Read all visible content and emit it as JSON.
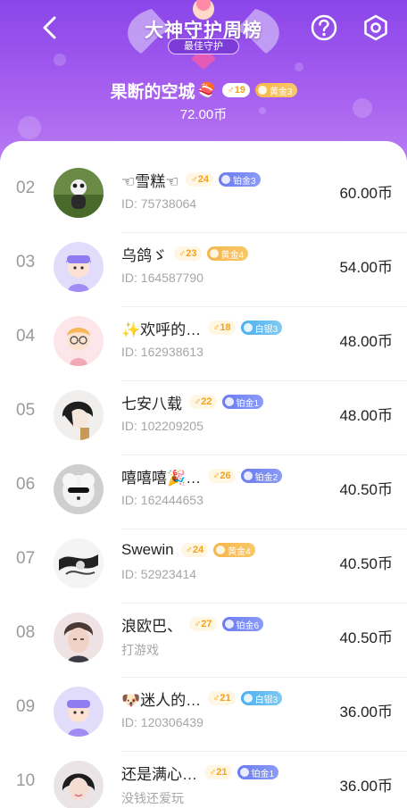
{
  "header": {
    "title": "大神守护周榜",
    "subtitle": "最佳守护",
    "top": {
      "name": "果断的空城",
      "emoji": "🍣",
      "sex_age": "♂19",
      "level": "黄金3",
      "amount": "72.00币"
    },
    "colors": {
      "bg_top": "#8a45e9",
      "bg_bottom": "#b97ef3"
    }
  },
  "list": [
    {
      "rank": "02",
      "name": "☜雪糕☜",
      "sex_age": "♂24",
      "level": "铂金3",
      "tier": "plat",
      "sub": "ID:  75738064",
      "amount": "60.00币"
    },
    {
      "rank": "03",
      "name": "乌鸽ゞ",
      "sex_age": "♂23",
      "level": "黄金4",
      "tier": "gold",
      "sub": "ID:  164587790",
      "amount": "54.00币"
    },
    {
      "rank": "04",
      "name": "✨欢呼的…",
      "sex_age": "♂18",
      "level": "白银3",
      "tier": "silver",
      "sub": "ID:  162938613",
      "amount": "48.00币"
    },
    {
      "rank": "05",
      "name": "七安八载",
      "sex_age": "♂22",
      "level": "铂金1",
      "tier": "plat",
      "sub": "ID:  102209205",
      "amount": "48.00币"
    },
    {
      "rank": "06",
      "name": "嘻嘻嘻🎉…",
      "sex_age": "♂26",
      "level": "铂金2",
      "tier": "plat",
      "sub": "ID:  162444653",
      "amount": "40.50币"
    },
    {
      "rank": "07",
      "name": "Swewin",
      "sex_age": "♂24",
      "level": "黄金4",
      "tier": "gold",
      "sub": "ID:  52923414",
      "amount": "40.50币"
    },
    {
      "rank": "08",
      "name": "浪欧巴、",
      "sex_age": "♂27",
      "level": "铂金6",
      "tier": "plat",
      "sub": "打游戏",
      "amount": "40.50币"
    },
    {
      "rank": "09",
      "name": "🐶迷人的…",
      "sex_age": "♂21",
      "level": "白银3",
      "tier": "silver",
      "sub": "ID:  120306439",
      "amount": "36.00币"
    },
    {
      "rank": "10",
      "name": "还是满心…",
      "sex_age": "♂21",
      "level": "铂金1",
      "tier": "plat",
      "sub": "没钱还爱玩",
      "amount": "36.00币"
    }
  ]
}
